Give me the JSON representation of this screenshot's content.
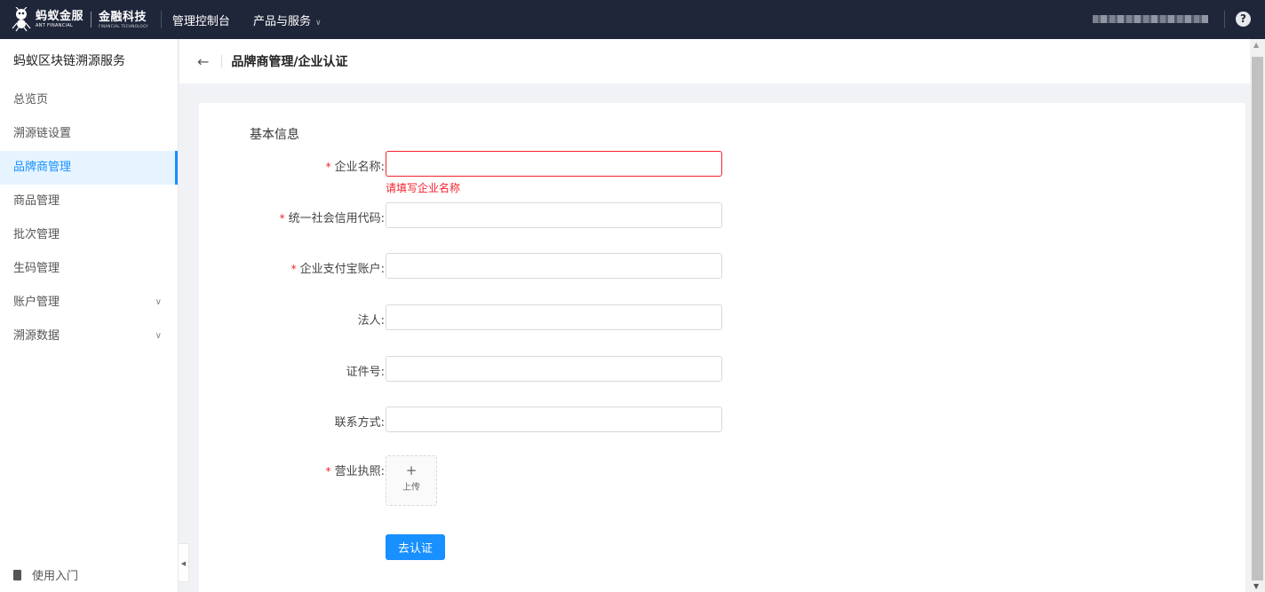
{
  "topbar": {
    "logo_cn": "蚂蚁金服",
    "logo_en": "ANT FINANCIAL",
    "logo2_cn": "金融科技",
    "logo2_en": "FINANCIAL TECHNOLOGY",
    "nav_console": "管理控制台",
    "nav_products": "产品与服务",
    "help": "?"
  },
  "sidebar": {
    "title": "蚂蚁区块链溯源服务",
    "items": [
      {
        "label": "总览页"
      },
      {
        "label": "溯源链设置"
      },
      {
        "label": "品牌商管理"
      },
      {
        "label": "商品管理"
      },
      {
        "label": "批次管理"
      },
      {
        "label": "生码管理"
      },
      {
        "label": "账户管理"
      },
      {
        "label": "溯源数据"
      }
    ],
    "footer": "使用入门"
  },
  "header": {
    "back": "←",
    "title": "品牌商管理/企业认证"
  },
  "form": {
    "section_title": "基本信息",
    "required_mark": "*",
    "fields": [
      {
        "label": "企业名称:",
        "value": ""
      },
      {
        "label": "统一社会信用代码:",
        "value": ""
      },
      {
        "label": "企业支付宝账户:",
        "value": ""
      },
      {
        "label": "法人:",
        "value": ""
      },
      {
        "label": "证件号:",
        "value": ""
      },
      {
        "label": "联系方式:",
        "value": ""
      }
    ],
    "error_company_name": "请填写企业名称",
    "license_label": "营业执照:",
    "upload_plus": "+",
    "upload_text": "上传",
    "submit": "去认证"
  },
  "colors": {
    "topbar_bg": "#20263a",
    "primary": "#1890ff",
    "error": "#f5222d"
  }
}
